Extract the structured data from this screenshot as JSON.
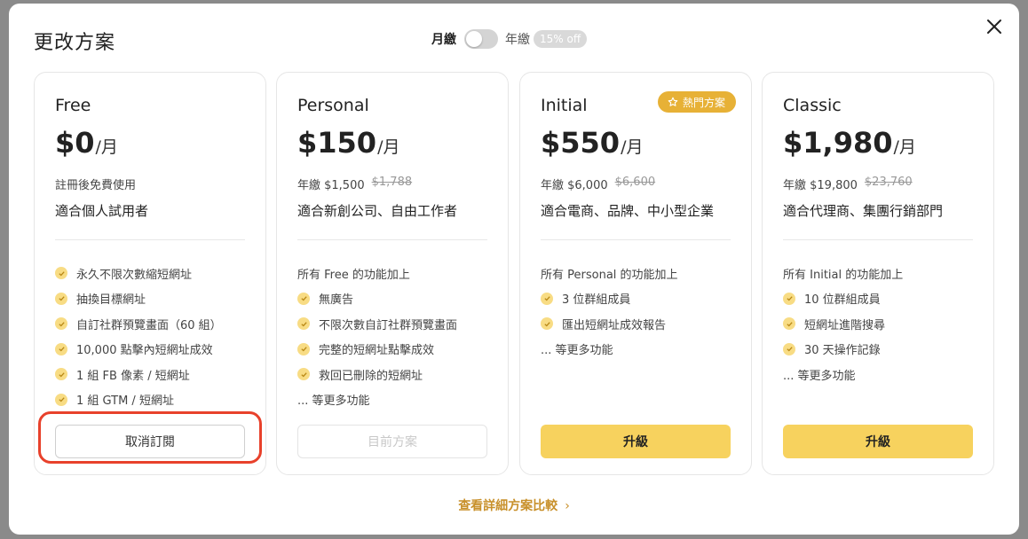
{
  "modal": {
    "title": "更改方案",
    "billing": {
      "monthly": "月繳",
      "yearly": "年繳",
      "discount": "15% off",
      "annual_selected": false
    },
    "close_icon": "close-icon"
  },
  "plans": [
    {
      "name": "Free",
      "price": "$0",
      "per": "/月",
      "sub_text": "註冊後免費使用",
      "sub_strike": "",
      "target": "適合個人試用者",
      "features": [
        "永久不限次數縮短網址",
        "抽換目標網址",
        "自訂社群預覽畫面（60 組）",
        "10,000 點擊內短網址成效",
        "1 組 FB 像素 / 短網址",
        "1 組 GTM / 短網址"
      ],
      "button": "取消訂閱"
    },
    {
      "name": "Personal",
      "price": "$150",
      "per": "/月",
      "sub_text": "年繳 $1,500",
      "sub_strike": "$1,788",
      "target": "適合新創公司、自由工作者",
      "intro": "所有 Free 的功能加上",
      "features": [
        "無廣告",
        "不限次數自訂社群預覽畫面",
        "完整的短網址點擊成效",
        "救回已刪除的短網址"
      ],
      "more": "... 等更多功能",
      "button": "目前方案"
    },
    {
      "name": "Initial",
      "price": "$550",
      "per": "/月",
      "badge": "熱門方案",
      "sub_text": "年繳 $6,000",
      "sub_strike": "$6,600",
      "target": "適合電商、品牌、中小型企業",
      "intro": "所有 Personal 的功能加上",
      "features": [
        "3 位群組成員",
        "匯出短網址成效報告"
      ],
      "more": "... 等更多功能",
      "button": "升級"
    },
    {
      "name": "Classic",
      "price": "$1,980",
      "per": "/月",
      "sub_text": "年繳 $19,800",
      "sub_strike": "$23,760",
      "target": "適合代理商、集團行銷部門",
      "intro": "所有 Initial 的功能加上",
      "features": [
        "10 位群組成員",
        "短網址進階搜尋",
        "30 天操作記錄"
      ],
      "more": "... 等更多功能",
      "button": "升級"
    }
  ],
  "compare_link": "查看詳細方案比較",
  "colors": {
    "accent": "#f7d25e",
    "badge": "#e7b136",
    "link": "#c8902a",
    "highlight": "#e8412b"
  }
}
